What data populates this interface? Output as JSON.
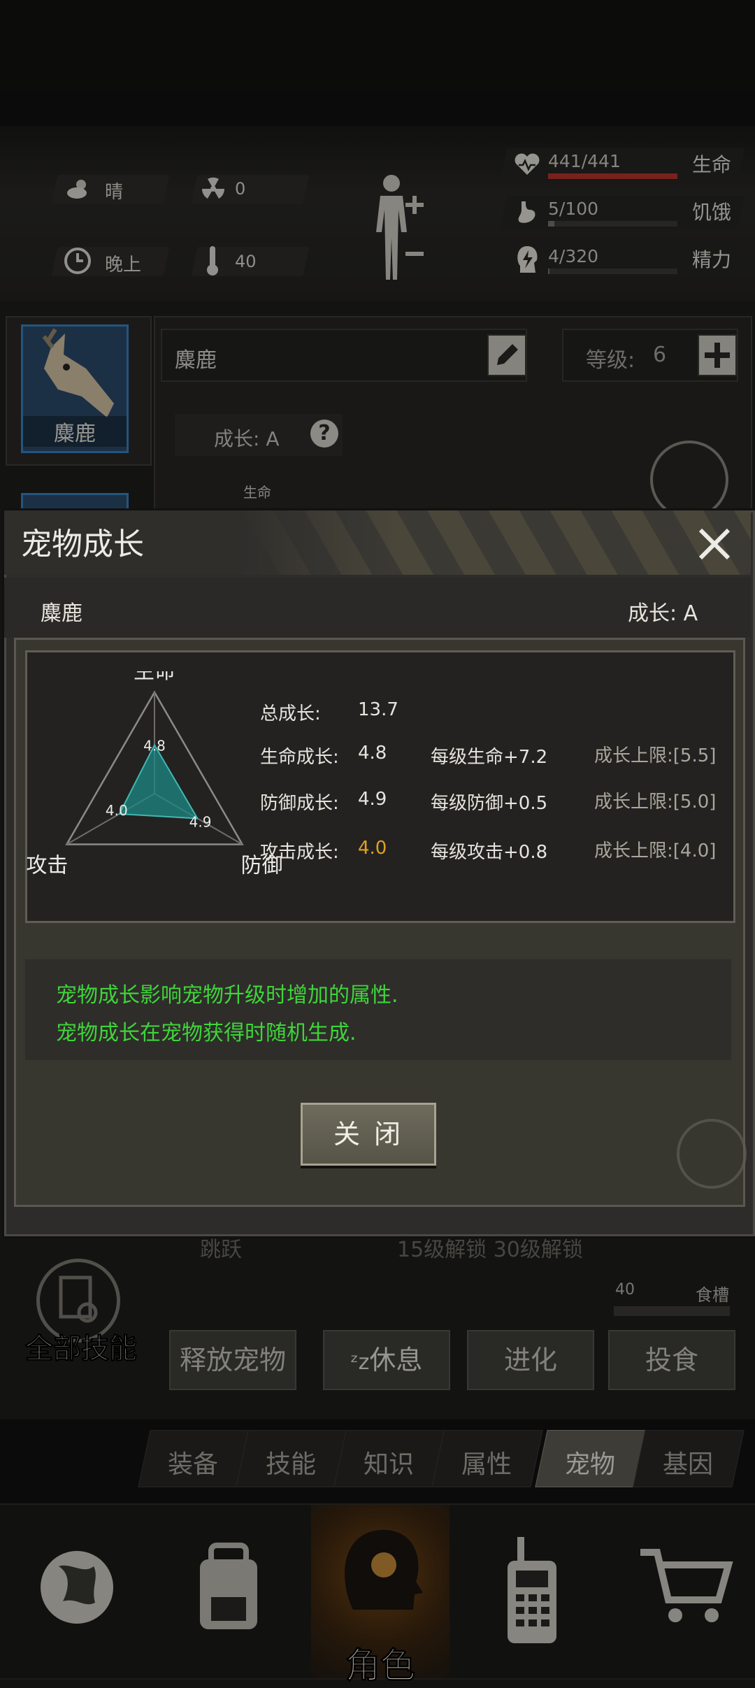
{
  "status": {
    "weather": "晴",
    "radiation": "0",
    "time_of_day": "晚上",
    "temperature": "40",
    "bars": [
      {
        "name": "生命",
        "value": "441/441",
        "fill": 1.0,
        "color": "#b8352c"
      },
      {
        "name": "饥饿",
        "value": "5/100",
        "fill": 0.05,
        "color": "#7a766c"
      },
      {
        "name": "精力",
        "value": "4/320",
        "fill": 0.0125,
        "color": "#7a766c"
      }
    ]
  },
  "pet_page": {
    "pet_card_name": "麋鹿",
    "name_field": "麋鹿",
    "level_label": "等级:",
    "level_value": "6",
    "growth_label": "成长: A",
    "chart_snip_label": "生命",
    "unlock_row_name": "跳跃",
    "unlock_row_text": "15级解锁  30级解锁",
    "trough_value": "40",
    "trough_label": "食槽",
    "all_skills": "全部技能",
    "actions": [
      "释放宠物",
      "休息",
      "进化",
      "投食"
    ]
  },
  "tabs": [
    "装备",
    "技能",
    "知识",
    "属性",
    "宠物",
    "基因"
  ],
  "active_tab": "宠物",
  "bottom_nav": {
    "items": [
      {
        "icon": "globe-icon",
        "label": ""
      },
      {
        "icon": "backpack-icon",
        "label": ""
      },
      {
        "icon": "character-head-icon",
        "label": "角色"
      },
      {
        "icon": "radio-icon",
        "label": ""
      },
      {
        "icon": "cart-icon",
        "label": ""
      }
    ],
    "active": "角色"
  },
  "dialog": {
    "title": "宠物成长",
    "pet_name": "麋鹿",
    "growth_grade": "成长: A",
    "radar": {
      "axes": [
        "生命",
        "防御",
        "攻击"
      ],
      "values": [
        4.8,
        4.9,
        4.0
      ],
      "labels": [
        "4.8",
        "4.9",
        "4.0"
      ],
      "max": 10,
      "fill_color": "#1e8a86"
    },
    "total_growth_label": "总成长:",
    "total_growth_value": "13.7",
    "rows": [
      {
        "label": "生命成长:",
        "value": "4.8",
        "per_level": "每级生命+7.2",
        "limit": "成长上限:[5.5]"
      },
      {
        "label": "防御成长:",
        "value": "4.9",
        "per_level": "每级防御+0.5",
        "limit": "成长上限:[5.0]"
      },
      {
        "label": "攻击成长:",
        "value": "4.0",
        "per_level": "每级攻击+0.8",
        "limit": "成长上限:[4.0]",
        "value_color": "#e0a020"
      }
    ],
    "info_lines": [
      "宠物成长影响宠物升级时增加的属性.",
      "宠物成长在宠物获得时随机生成."
    ],
    "close_label": "关 闭",
    "accent_green": "#3fd43a"
  }
}
